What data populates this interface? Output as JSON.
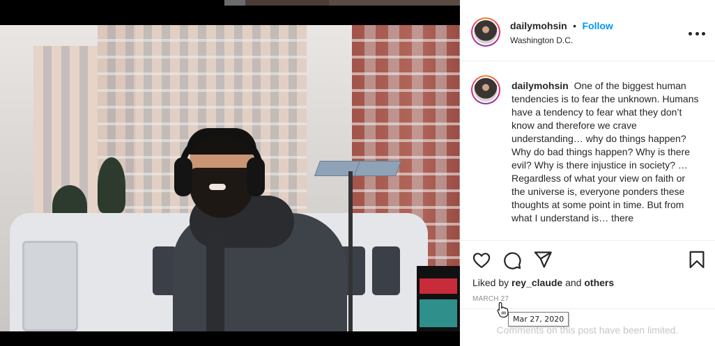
{
  "post": {
    "username": "dailymohsin",
    "separator": "•",
    "follow_label": "Follow",
    "location": "Washington D.C."
  },
  "caption": {
    "username": "dailymohsin",
    "text": "One of the biggest human tendencies is to fear the unknown. Humans have a tendency to fear what they don’t know and therefore we crave understanding… why do things happen? Why do bad things happen? Why is there evil? Why is there injustice in society? … Regardless of what your view on faith or the universe is, everyone ponders these thoughts at some point in time. But from what I understand is… there"
  },
  "likes": {
    "prefix": "Liked by",
    "user": "rey_claude",
    "and": "and",
    "others": "others"
  },
  "date": {
    "label": "MARCH 27",
    "tooltip": "Mar 27, 2020"
  },
  "comments": {
    "limited_text": "Comments on this post have been limited."
  },
  "icons": {
    "like": "heart-icon",
    "comment": "comment-icon",
    "share": "paper-plane-icon",
    "save": "bookmark-icon",
    "more": "more-options-icon"
  },
  "colors": {
    "follow": "#0095f6",
    "text": "#262626",
    "muted": "#8e8e8e",
    "border": "#efefef"
  }
}
